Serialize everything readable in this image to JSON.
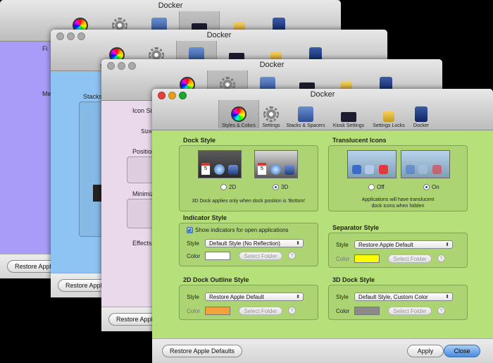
{
  "app_title": "Docker",
  "toolbar": {
    "items": [
      {
        "label": "Styles & Colors",
        "icon": "color-wheel-icon"
      },
      {
        "label": "Settings",
        "icon": "gear-icon"
      },
      {
        "label": "Stacks & Spacers",
        "icon": "stacks-icon"
      },
      {
        "label": "Kiosk Settings",
        "icon": "kiosk-icon"
      },
      {
        "label": "Settings Locks",
        "icon": "lock-icon"
      },
      {
        "label": "Docker",
        "icon": "docker-app-icon"
      }
    ]
  },
  "back_windows": {
    "win1": {
      "bg": "#a99cf8",
      "labels": [
        "Fi",
        "Me"
      ]
    },
    "win2": {
      "bg": "#8ec4f3",
      "labels": [
        "Stacks"
      ]
    },
    "win3": {
      "bg": "#e9d9ea",
      "labels": [
        "Icon Siz",
        "Size o",
        "Position",
        "Minimiz",
        "Effects"
      ]
    }
  },
  "front": {
    "bg": "#b6e07a",
    "dock_style": {
      "title": "Dock Style",
      "option_2d": "2D",
      "option_3d": "3D",
      "selected": "3D",
      "note": "3D Dock applies only when dock position is 'Bottom'"
    },
    "translucent_icons": {
      "title": "Translucent Icons",
      "option_off": "Off",
      "option_on": "On",
      "selected": "On",
      "note_line1": "Applications will have translucent",
      "note_line2": "dock icons when hidden"
    },
    "indicator_style": {
      "title": "Indicator Style",
      "checkbox_label": "Show indicators for open applications",
      "checked": true,
      "style_label": "Style",
      "style_value": "Default Style (No Reflection)",
      "color_label": "Color",
      "color": "#ffffff",
      "folder_button": "Select Folder",
      "help": "?"
    },
    "separator_style": {
      "title": "Separator Style",
      "style_label": "Style",
      "style_value": "Restore Apple Default",
      "color_label": "Color",
      "color": "#ffff00",
      "folder_button": "Select Folder",
      "help": "?"
    },
    "outline_style_2d": {
      "title": "2D Dock Outline Style",
      "style_label": "Style",
      "style_value": "Restore Apple Default",
      "color_label": "Color",
      "color": "#f2a33a",
      "folder_button": "Select Folder",
      "help": "?"
    },
    "dock_style_3d": {
      "title": "3D Dock Style",
      "style_label": "Style",
      "style_value": "Default Style, Custom Color",
      "color_label": "Color",
      "color": "#8a8a8a",
      "folder_button": "Select Folder",
      "help": "?"
    },
    "footer": {
      "restore": "Restore Apple Defaults",
      "apply": "Apply",
      "close": "Close"
    }
  },
  "back_footer": {
    "restore_w1": "Restore Apple",
    "restore_w2": "Restore Apple",
    "restore_w3": "Restore Appl"
  },
  "calendar_day": "5"
}
